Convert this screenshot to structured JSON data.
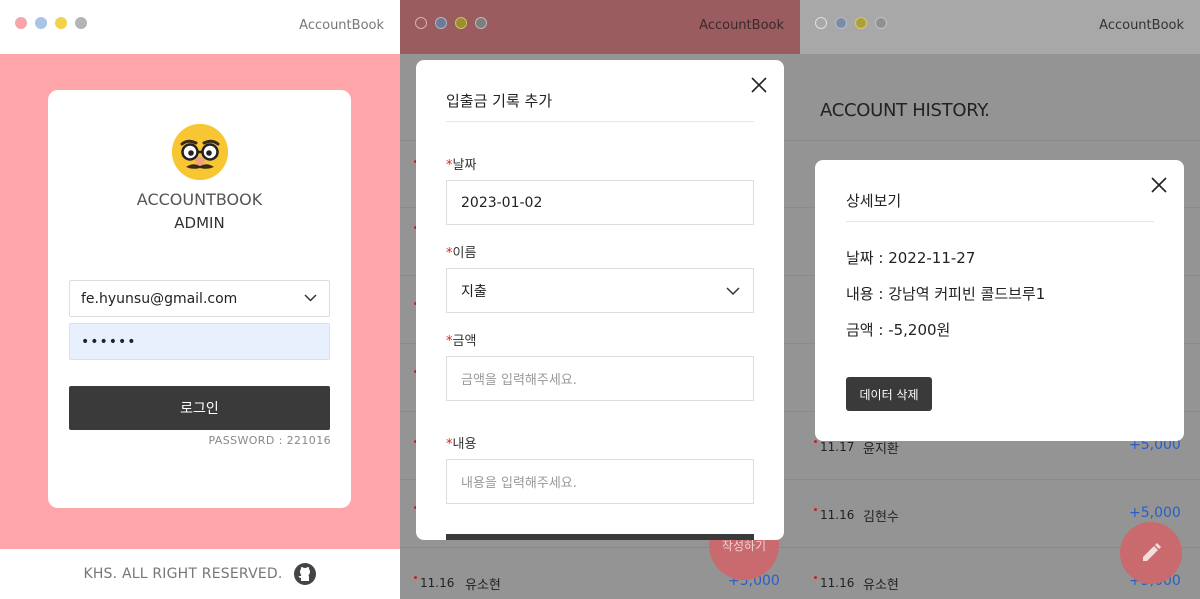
{
  "app": {
    "title": "AccountBook",
    "dot_colors": [
      "#f7a5ac",
      "#a9c4e6",
      "#f2d14b",
      "#b4b4b4"
    ]
  },
  "login": {
    "brand": "ACCOUNTBOOK",
    "role": "ADMIN",
    "email": "fe.hyunsu@gmail.com",
    "password_mask": "••••••",
    "login_label": "로그인",
    "password_hint": "PASSWORD : 221016",
    "footer_text": "KHS. ALL RIGHT RESERVED."
  },
  "add_modal": {
    "title": "입출금 기록 추가",
    "required_mark": "*",
    "date_label": "날짜",
    "date_value": "2023-01-02",
    "name_label": "이름",
    "name_value": "지출",
    "amount_label": "금액",
    "amount_placeholder": "금액을 입력해주세요.",
    "memo_label": "내용",
    "memo_placeholder": "내용을 입력해주세요.",
    "fab_label": "작성하기"
  },
  "history": {
    "title": "ACCOUNT HISTORY.",
    "rows_panel2": [
      {
        "date": "11.16",
        "name": "유소현",
        "amount": "+5,000"
      }
    ],
    "rows_panel3": [
      {
        "date": "11.17",
        "name": "윤지환",
        "amount": "+5,000"
      },
      {
        "date": "11.16",
        "name": "김현수",
        "amount": "+5,000"
      },
      {
        "date": "11.16",
        "name": "유소현",
        "amount": "+5,000"
      }
    ]
  },
  "detail_modal": {
    "title": "상세보기",
    "date_line": "날짜 : 2022-11-27",
    "memo_line": "내용 : 강남역 커피빈 콜드브루1",
    "amount_line": "금액 : -5,200원",
    "delete_label": "데이터 삭제"
  }
}
